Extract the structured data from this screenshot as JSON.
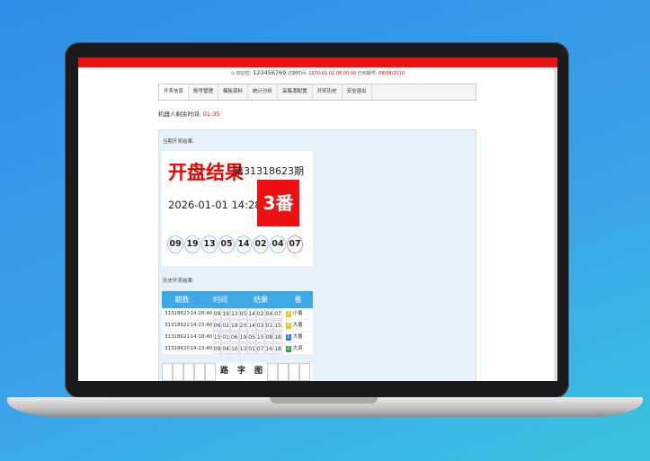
{
  "status": {
    "prefix": "欢迎您:",
    "user_id": "123456769",
    "expire_label": "过期时间:",
    "expire_value": "1970-01-01 08:00:00",
    "extra_label": "已到期号:",
    "extra_value": "08/08/2010"
  },
  "nav": {
    "tabs": [
      "开奖信息",
      "账号管理",
      "模板资料",
      "统计分析",
      "采集源配置",
      "开奖历史",
      "安全退出"
    ]
  },
  "robot": {
    "label": "机器人剩余时间:",
    "value": "01:35"
  },
  "current": {
    "section_label": "当期开奖结果:",
    "title": "开盘结果",
    "period": "第31318623期",
    "datetime": "2026-01-01 14:28:40",
    "fan": "3番",
    "numbers": [
      "09",
      "19",
      "13",
      "05",
      "14",
      "02",
      "04",
      "07"
    ]
  },
  "history": {
    "section_label": "历史开奖结果:",
    "headers": [
      "期数",
      "时间",
      "结果",
      "番"
    ],
    "rows": [
      {
        "period": "31318623",
        "time": "14:28:40",
        "nums": [
          "09",
          "19",
          "13",
          "05",
          "14",
          "02",
          "04",
          "07"
        ],
        "fan_num": "3",
        "fan_text": "小番",
        "color": "#f0c419"
      },
      {
        "period": "31318622",
        "time": "14:23:40",
        "nums": [
          "06",
          "02",
          "19",
          "20",
          "14",
          "03",
          "01",
          "15"
        ],
        "fan_num": "3",
        "fan_text": "大番",
        "color": "#f0c419"
      },
      {
        "period": "31318621",
        "time": "14:18:40",
        "nums": [
          "15",
          "01",
          "06",
          "19",
          "05",
          "15",
          "08",
          "18"
        ],
        "fan_num": "1",
        "fan_text": "大番",
        "color": "#3b7be0"
      },
      {
        "period": "31318620",
        "time": "14:13:40",
        "nums": [
          "09",
          "04",
          "10",
          "13",
          "01",
          "07",
          "16",
          "18"
        ],
        "fan_num": "2",
        "fan_text": "大双",
        "color": "#2aa84a"
      }
    ]
  },
  "luzi": {
    "chars": [
      "路",
      "字",
      "图"
    ]
  },
  "colors": {
    "brand_red": "#ee1111",
    "header_blue": "#3fa9e6"
  }
}
